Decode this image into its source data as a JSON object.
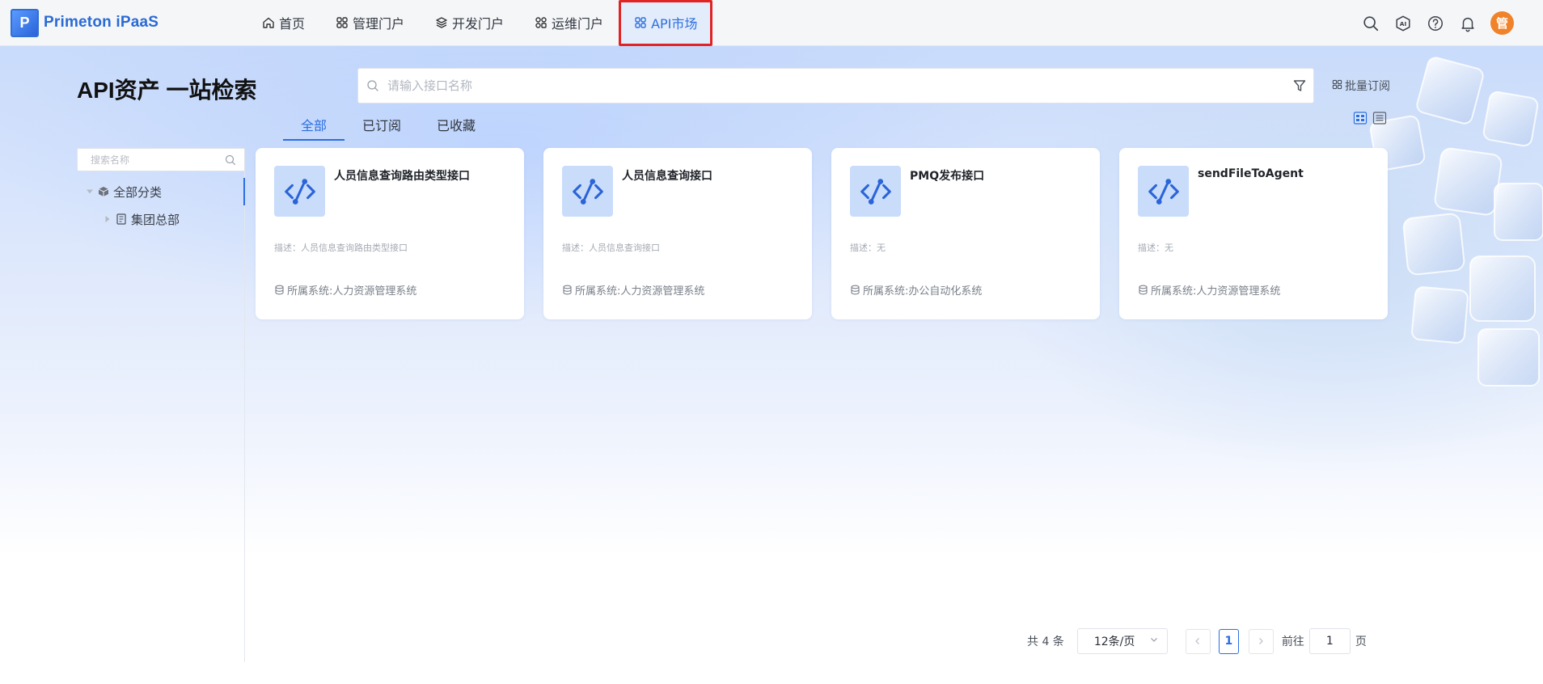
{
  "brand": {
    "logo_letter": "P",
    "name": "Primeton iPaaS"
  },
  "nav": {
    "items": [
      {
        "label": "首页",
        "icon": "home-icon"
      },
      {
        "label": "管理门户",
        "icon": "grid-icon"
      },
      {
        "label": "开发门户",
        "icon": "layers-icon"
      },
      {
        "label": "运维门户",
        "icon": "grid-icon"
      },
      {
        "label": "API市场",
        "icon": "grid-icon",
        "active": true
      }
    ]
  },
  "header_icons": [
    "search-icon",
    "ai-icon",
    "help-icon",
    "bell-icon"
  ],
  "user": {
    "avatar_text": "管"
  },
  "page": {
    "title": "API资产 一站检索",
    "search_placeholder": "请输入接口名称",
    "batch_subscribe": "批量订阅"
  },
  "tabs": [
    {
      "label": "全部",
      "active": true
    },
    {
      "label": "已订阅"
    },
    {
      "label": "已收藏"
    }
  ],
  "sidebar": {
    "search_placeholder": "搜索名称",
    "root": "全部分类",
    "children": [
      "集团总部"
    ]
  },
  "cards": [
    {
      "title": "人员信息查询路由类型接口",
      "desc": "描述：人员信息查询路由类型接口",
      "system": "所属系统:人力资源管理系统"
    },
    {
      "title": "人员信息查询接口",
      "desc": "描述：人员信息查询接口",
      "system": "所属系统:人力资源管理系统"
    },
    {
      "title": "PMQ发布接口",
      "desc": "描述：无",
      "system": "所属系统:办公自动化系统"
    },
    {
      "title": "sendFileToAgent",
      "desc": "描述：无",
      "system": "所属系统:人力资源管理系统"
    }
  ],
  "pagination": {
    "total": "共 4 条",
    "page_size": "12条/页",
    "current_page": "1",
    "goto_label": "前往",
    "goto_value": "1",
    "page_suffix": "页"
  },
  "colors": {
    "accent": "#2b6fe0",
    "highlight_border": "#e02424",
    "avatar": "#f0822a"
  }
}
